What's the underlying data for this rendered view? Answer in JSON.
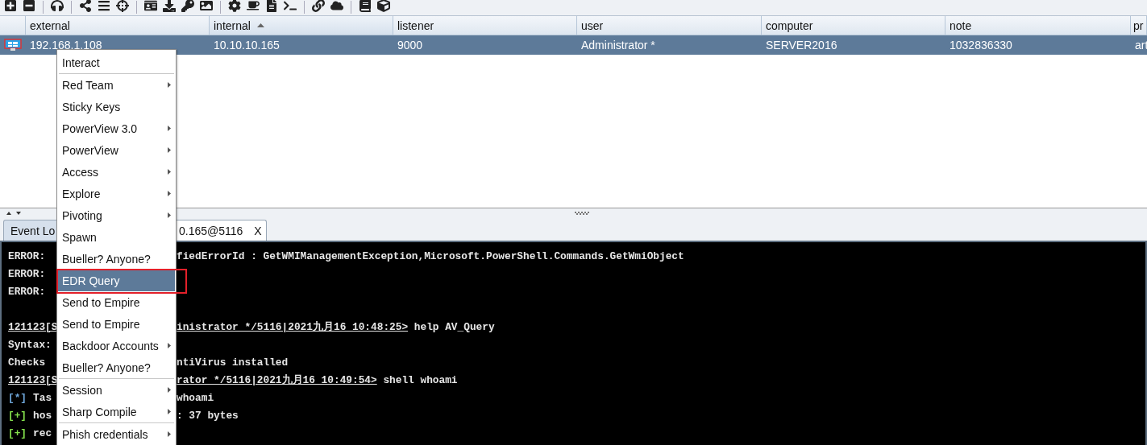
{
  "table": {
    "columns": [
      {
        "label": "external",
        "sorted": false
      },
      {
        "label": "internal",
        "sorted": true
      },
      {
        "label": "listener",
        "sorted": false
      },
      {
        "label": "user",
        "sorted": false
      },
      {
        "label": "computer",
        "sorted": false
      },
      {
        "label": "note",
        "sorted": false
      },
      {
        "label": "pr"
      }
    ],
    "rows": [
      {
        "selected": true,
        "cells": [
          "192.168.1.108",
          "10.10.10.165",
          "9000",
          "Administrator *",
          "SERVER2016",
          "1032836330",
          "art"
        ]
      }
    ]
  },
  "context_menu": {
    "items": [
      {
        "kind": "item",
        "label": "Interact",
        "submenu": false,
        "selected": false,
        "annotated": false
      },
      {
        "kind": "separator"
      },
      {
        "kind": "item",
        "label": "Red Team",
        "submenu": true,
        "selected": false,
        "annotated": false
      },
      {
        "kind": "item",
        "label": "Sticky Keys",
        "submenu": false,
        "selected": false,
        "annotated": false
      },
      {
        "kind": "item",
        "label": "PowerView 3.0",
        "submenu": true,
        "selected": false,
        "annotated": false
      },
      {
        "kind": "item",
        "label": "PowerView",
        "submenu": true,
        "selected": false,
        "annotated": false
      },
      {
        "kind": "item",
        "label": "Access",
        "submenu": true,
        "selected": false,
        "annotated": false
      },
      {
        "kind": "item",
        "label": "Explore",
        "submenu": true,
        "selected": false,
        "annotated": false
      },
      {
        "kind": "item",
        "label": "Pivoting",
        "submenu": true,
        "selected": false,
        "annotated": false
      },
      {
        "kind": "item",
        "label": "Spawn",
        "submenu": false,
        "selected": false,
        "annotated": false
      },
      {
        "kind": "item",
        "label": "Bueller? Anyone?",
        "submenu": false,
        "selected": false,
        "annotated": false
      },
      {
        "kind": "item",
        "label": "EDR Query",
        "submenu": false,
        "selected": true,
        "annotated": true
      },
      {
        "kind": "item",
        "label": "Send to Empire",
        "submenu": false,
        "selected": false,
        "annotated": false
      },
      {
        "kind": "item",
        "label": "Send to Empire",
        "submenu": false,
        "selected": false,
        "annotated": false
      },
      {
        "kind": "item",
        "label": "Backdoor Accounts",
        "submenu": true,
        "selected": false,
        "annotated": false
      },
      {
        "kind": "item",
        "label": "Bueller? Anyone?",
        "submenu": false,
        "selected": false,
        "annotated": false
      },
      {
        "kind": "separator"
      },
      {
        "kind": "item",
        "label": "Session",
        "submenu": true,
        "selected": false,
        "annotated": false
      },
      {
        "kind": "item",
        "label": "Sharp Compile",
        "submenu": true,
        "selected": false,
        "annotated": false
      },
      {
        "kind": "separator"
      },
      {
        "kind": "item",
        "label": "Phish credentials",
        "submenu": true,
        "selected": false,
        "annotated": false
      }
    ]
  },
  "tabs": [
    {
      "label": "Event Lo",
      "selected": false
    },
    {
      "label": "0.165@5116",
      "close": "X",
      "selected": true
    }
  ],
  "console": {
    "lines": [
      {
        "kind": "plain",
        "left": "ERROR:",
        "right": "fiedErrorId : GetWMIManagementException,Microsoft.PowerShell.Commands.GetWmiObject"
      },
      {
        "kind": "plain",
        "left": "ERROR:"
      },
      {
        "kind": "plain",
        "left": "ERROR:"
      },
      {
        "kind": "blank"
      },
      {
        "kind": "prompt",
        "left": "121123[S",
        "right": "inistrator */5116|2021九月16 10:48:25>",
        "command": "help AV_Query"
      },
      {
        "kind": "plain",
        "left": "Syntax:"
      },
      {
        "kind": "plain",
        "left": "Checks",
        "right": "ntiVirus installed"
      },
      {
        "kind": "prompt",
        "left": "121123[S",
        "right": "rator */5116|2021九月16 10:49:54>",
        "command": "shell whoami"
      },
      {
        "kind": "tagged",
        "tag": "[*]",
        "color": "#6fa8dc",
        "left": "Tas",
        "right": "whoami"
      },
      {
        "kind": "tagged",
        "tag": "[+]",
        "color": "#84e04c",
        "left": "hos",
        "right": ": 37 bytes"
      },
      {
        "kind": "tagged",
        "tag": "[+]",
        "color": "#84e04c",
        "left": "rec"
      }
    ]
  }
}
